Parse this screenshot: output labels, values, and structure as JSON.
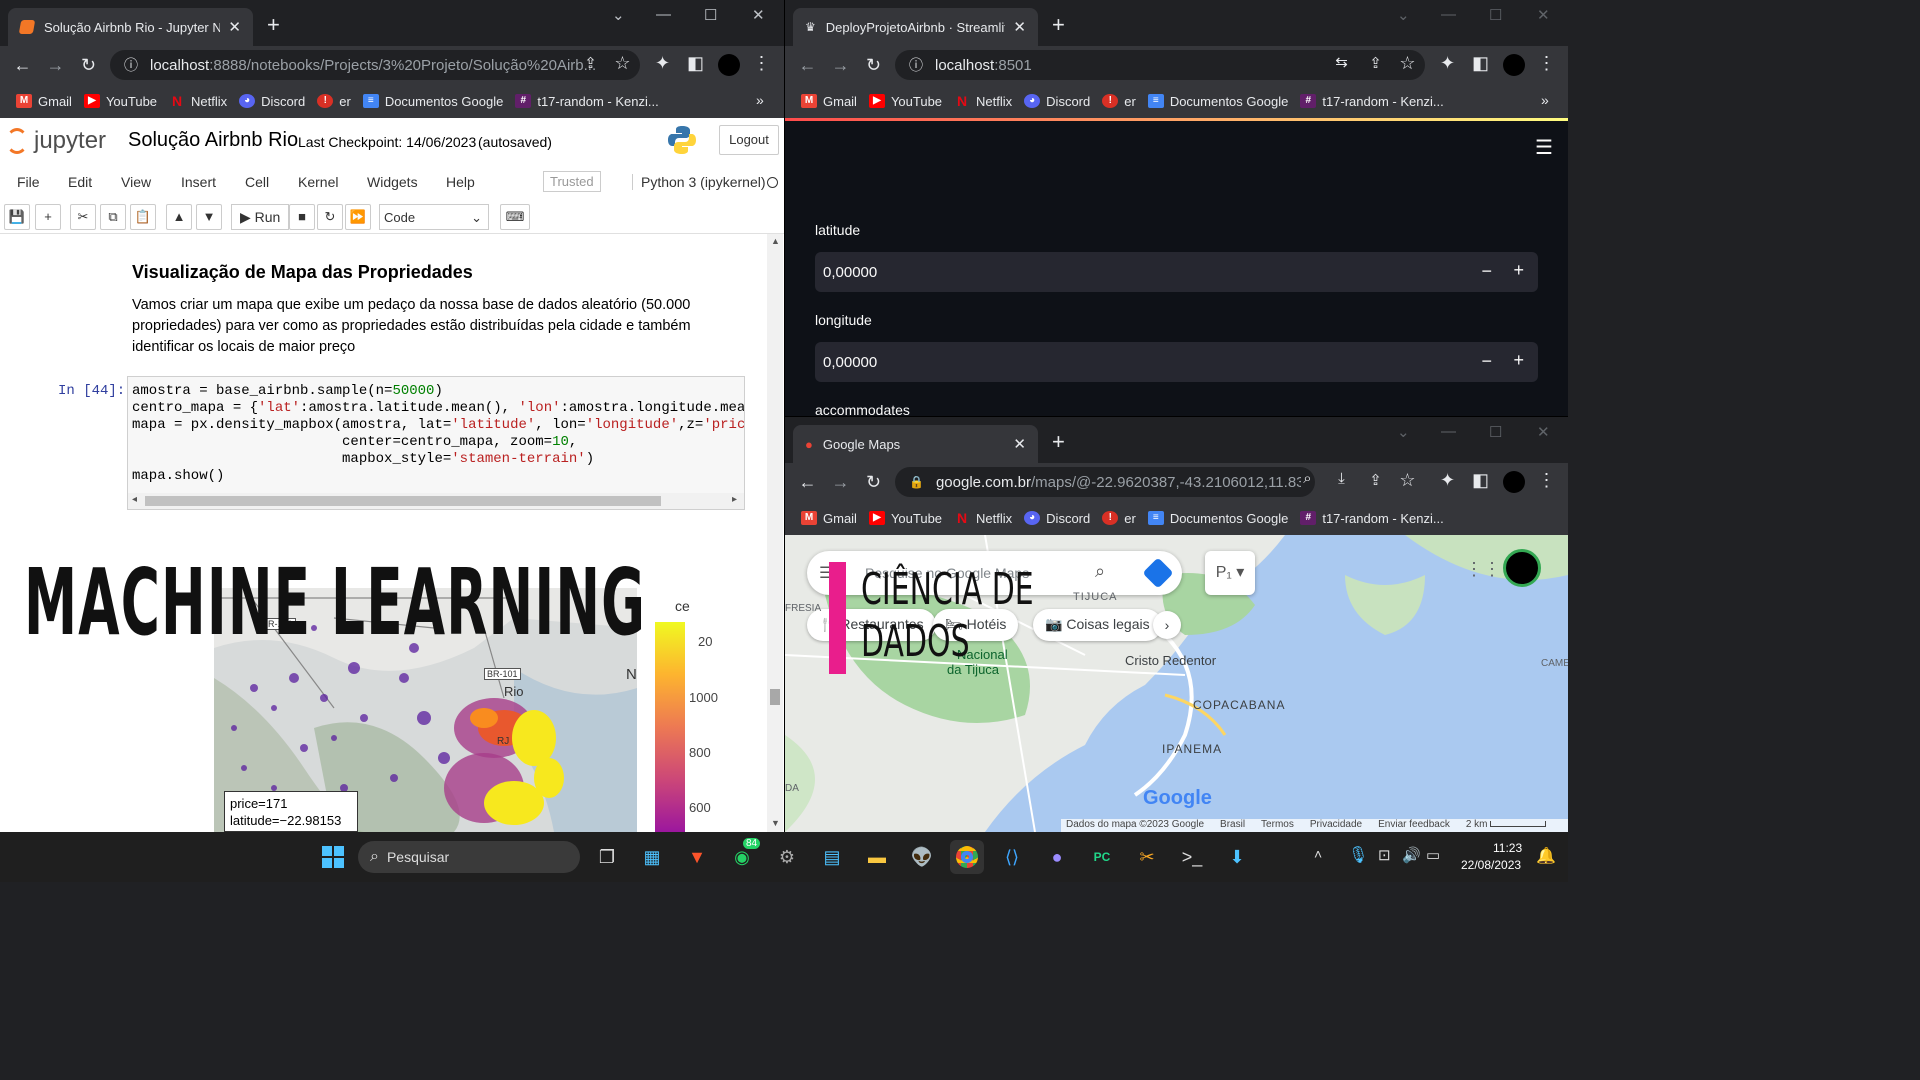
{
  "jupyter_window": {
    "tab_title": "Solução Airbnb Rio - Jupyter Not",
    "url_host": "localhost",
    "url_rest": ":8888/notebooks/Projects/3%20Projeto/Solução%20Airb...",
    "bookmarks": [
      "Gmail",
      "YouTube",
      "Netflix",
      "Discord",
      "er",
      "Documentos Google",
      "t17-random - Kenzi..."
    ],
    "logo_text": "jupyter",
    "notebook_name": "Solução Airbnb Rio",
    "checkpoint": "Last Checkpoint: 14/06/2023",
    "autosaved": "(autosaved)",
    "logout_label": "Logout",
    "menu": [
      "File",
      "Edit",
      "View",
      "Insert",
      "Cell",
      "Kernel",
      "Widgets",
      "Help"
    ],
    "trusted_label": "Trusted",
    "kernel_name": "Python 3 (ipykernel)",
    "run_label": "Run",
    "cell_type": "Code",
    "md_heading": "Visualização de Mapa das Propriedades",
    "md_paragraph": "Vamos criar um mapa que exibe um pedaço da nossa base de dados aleatório (50.000 propriedades) para ver como as propriedades estão distribuídas pela cidade e também identificar os locais de maior preço",
    "cell_prompt": "In [44]:",
    "colorbar_ticks": [
      "1000",
      "800",
      "600"
    ],
    "colorbar_top_partial": "20",
    "colorbar_title_partial": "ce",
    "map_labels": [
      "BR-101",
      "BR-101",
      "Rio",
      "RJ"
    ],
    "map_edge_letter": "N",
    "tooltip_price": "price=171",
    "tooltip_lat": "latitude=−22.98153"
  },
  "streamlit_window": {
    "tab_title": "DeployProjetoAirbnb · Streamlit",
    "url_host": "localhost",
    "url_rest": ":8501",
    "bookmarks": [
      "Gmail",
      "YouTube",
      "Netflix",
      "Discord",
      "er",
      "Documentos Google",
      "t17-random - Kenzi..."
    ],
    "fields": [
      {
        "label": "latitude",
        "value": "0,00000"
      },
      {
        "label": "longitude",
        "value": "0,00000"
      }
    ],
    "next_label": "accommodates"
  },
  "maps_window": {
    "tab_title": "Google Maps",
    "url_host": "google.com.br",
    "url_rest": "/maps/@-22.9620387,-43.2106012,11.83...",
    "bookmarks": [
      "Gmail",
      "YouTube",
      "Netflix",
      "Discord",
      "er",
      "Documentos Google",
      "t17-random - Kenzi..."
    ],
    "search_placeholder": "Pesquise no Google Maps",
    "chips": [
      "Restaurantes",
      "Hotéis",
      "Coisas legais"
    ],
    "places": [
      "TIJUCA",
      "Cristo Redentor",
      "Nacional",
      "da Tijuca",
      "COPACABANA",
      "IPANEMA",
      "CAME",
      "DA",
      "FRESIA"
    ],
    "google_logo": "Google",
    "footer": [
      "Dados do mapa ©2023 Google",
      "Brasil",
      "Termos",
      "Privacidade",
      "Enviar feedback",
      "2 km"
    ]
  },
  "overlay": {
    "title": "MACHINE LEARNING",
    "subtitle_line1": "CIÊNCIA DE",
    "subtitle_line2": "DADOS",
    "accent_color": "#e91e8c"
  },
  "taskbar": {
    "search_placeholder": "Pesquisar",
    "whatsapp_badge": "84",
    "time": "11:23",
    "date": "22/08/2023"
  }
}
